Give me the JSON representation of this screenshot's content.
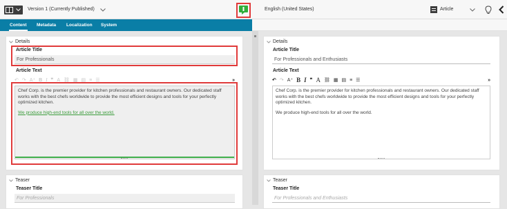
{
  "header": {
    "version_label": "Version 1 (Currently Published)",
    "locale_label": "English (United States)",
    "doc_type_label": "Article"
  },
  "tabs": [
    "Content",
    "Metadata",
    "Localization",
    "System"
  ],
  "left": {
    "details_label": "Details",
    "article_title_label": "Article Title",
    "article_title_value": "For Professionals",
    "article_text_label": "Article Text",
    "paragraph1": "Chef Corp. is the premier provider for kitchen professionals and restaurant owners. Our dedicated staff works with the best chefs worldwide to provide the most efficient designs and tools for your perfectly optimized kitchen.",
    "paragraph2": "We produce high-end tools for all over the world.",
    "teaser_label": "Teaser",
    "teaser_title_label": "Teaser Title",
    "teaser_title_placeholder": "For Professionals"
  },
  "right": {
    "details_label": "Details",
    "article_title_label": "Article Title",
    "article_title_value": "For Professionals  and Enthusiasts",
    "article_text_label": "Article Text",
    "paragraph1": "Chef Corp. is the premier provider for kitchen professionals and restaurant owners. Our dedicated staff works with the best chefs worldwide to provide the most efficient designs and tools for your perfectly optimized kitchen.",
    "paragraph2": "We produce high-end tools for all over the world.",
    "teaser_label": "Teaser",
    "teaser_title_label": "Teaser Title",
    "teaser_title_placeholder": "For Professionals  and Enthusiasts"
  },
  "colors": {
    "accent": "#0a7ea6",
    "highlight": "#e03a3a",
    "sync_icon": "#2fae3a"
  }
}
